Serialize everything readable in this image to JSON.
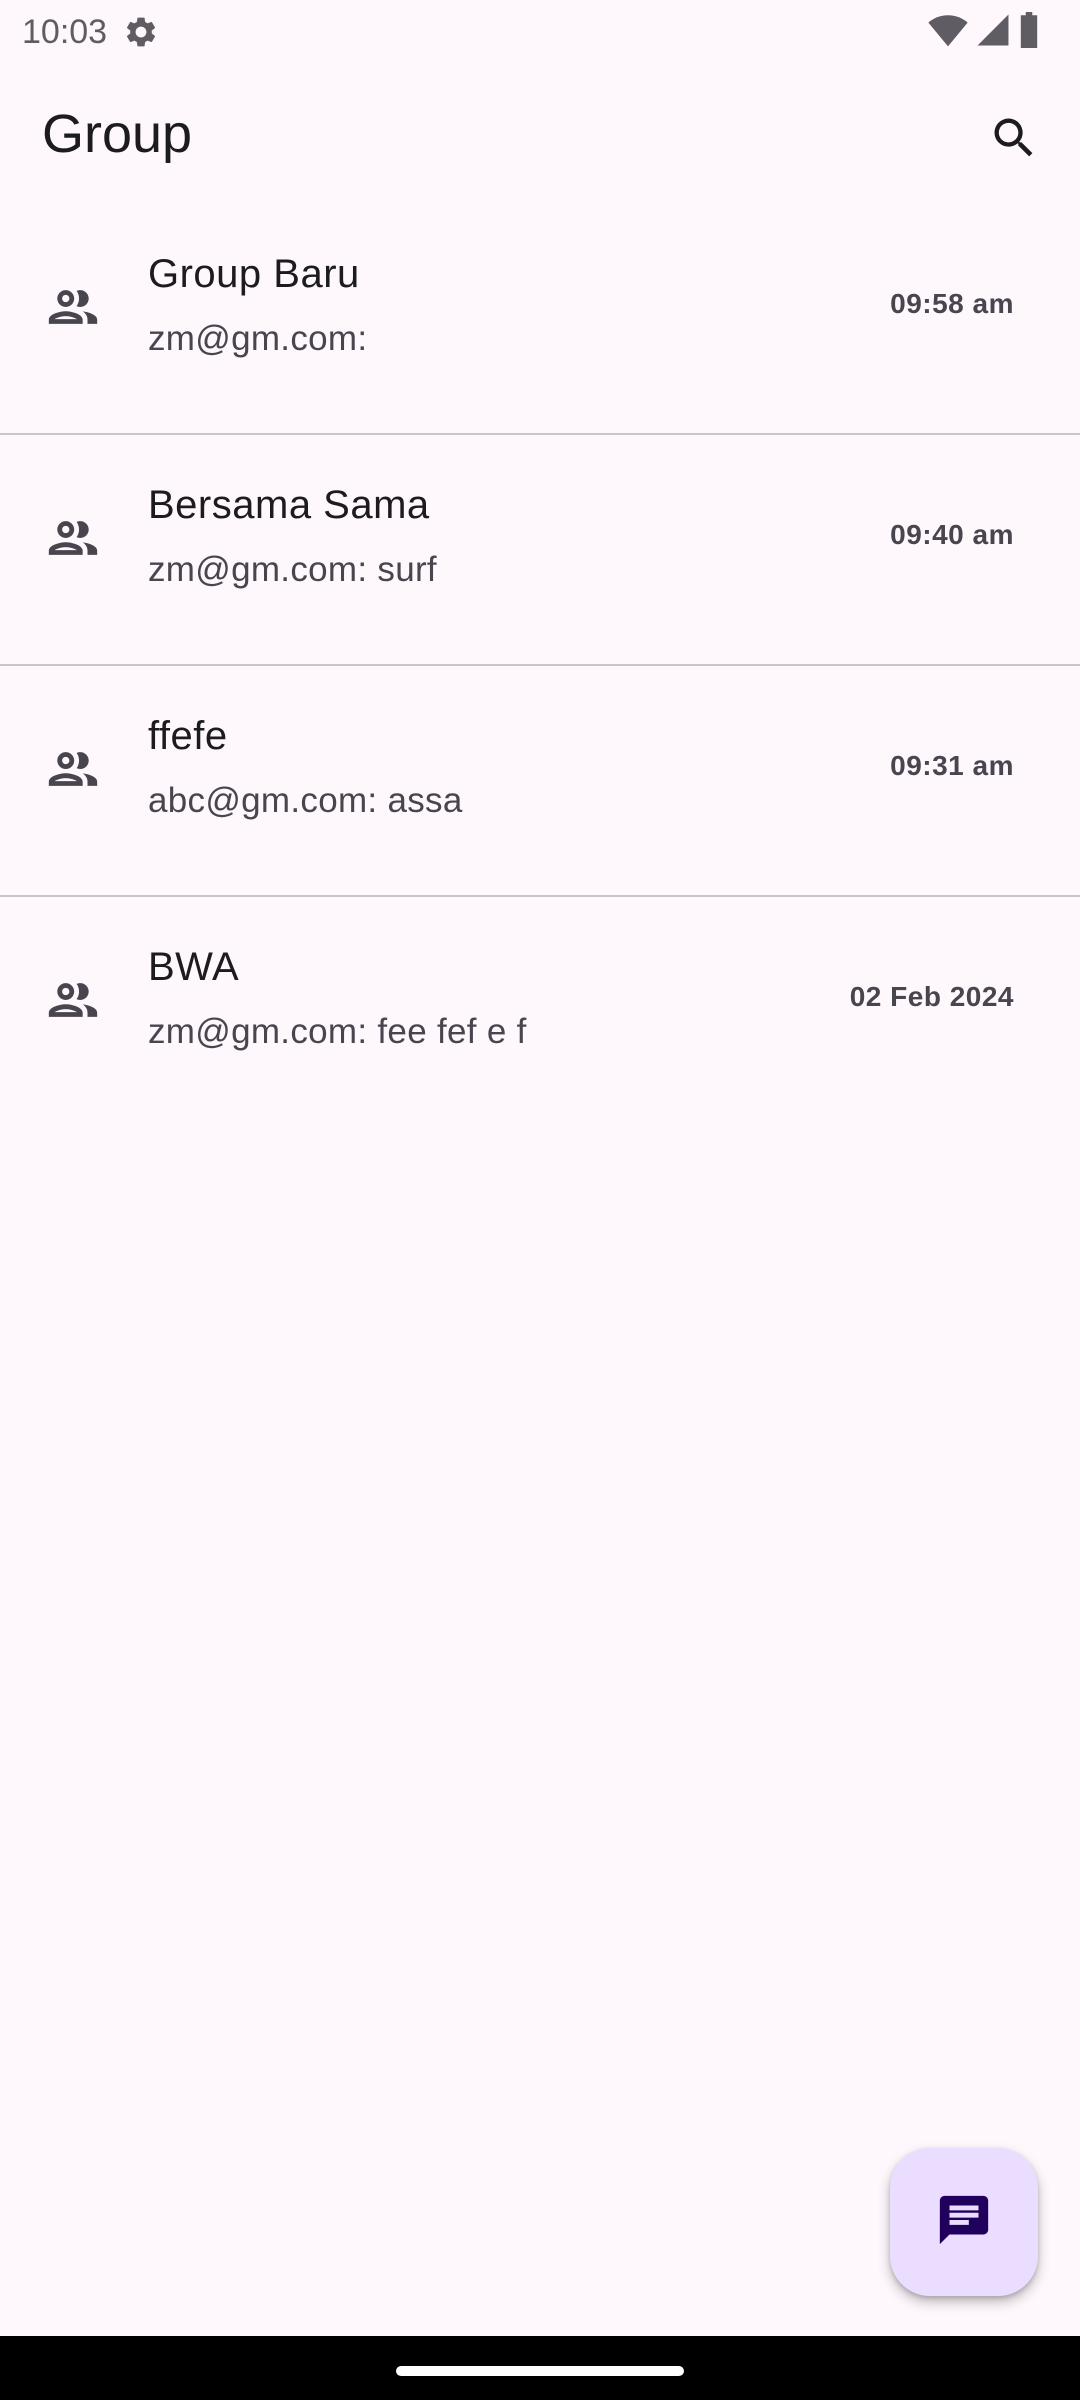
{
  "status_bar": {
    "time": "10:03",
    "icons": [
      "gear-icon",
      "wifi-icon",
      "signal-icon",
      "battery-icon"
    ]
  },
  "app_bar": {
    "title": "Group",
    "search_icon": "search-icon"
  },
  "groups": [
    {
      "name": "Group Baru",
      "last_message": "zm@gm.com:",
      "time": "09:58 am"
    },
    {
      "name": "Bersama Sama",
      "last_message": "zm@gm.com: surf",
      "time": "09:40 am"
    },
    {
      "name": "ffefe",
      "last_message": "abc@gm.com: assa",
      "time": "09:31 am"
    },
    {
      "name": "BWA",
      "last_message": "zm@gm.com: fee fef e f",
      "time": "02 Feb 2024"
    }
  ],
  "fab": {
    "icon": "message-icon"
  },
  "colors": {
    "background": "#fef7fc",
    "fab_background": "#eaddff",
    "fab_icon": "#21005d",
    "divider": "#cac4cf"
  }
}
